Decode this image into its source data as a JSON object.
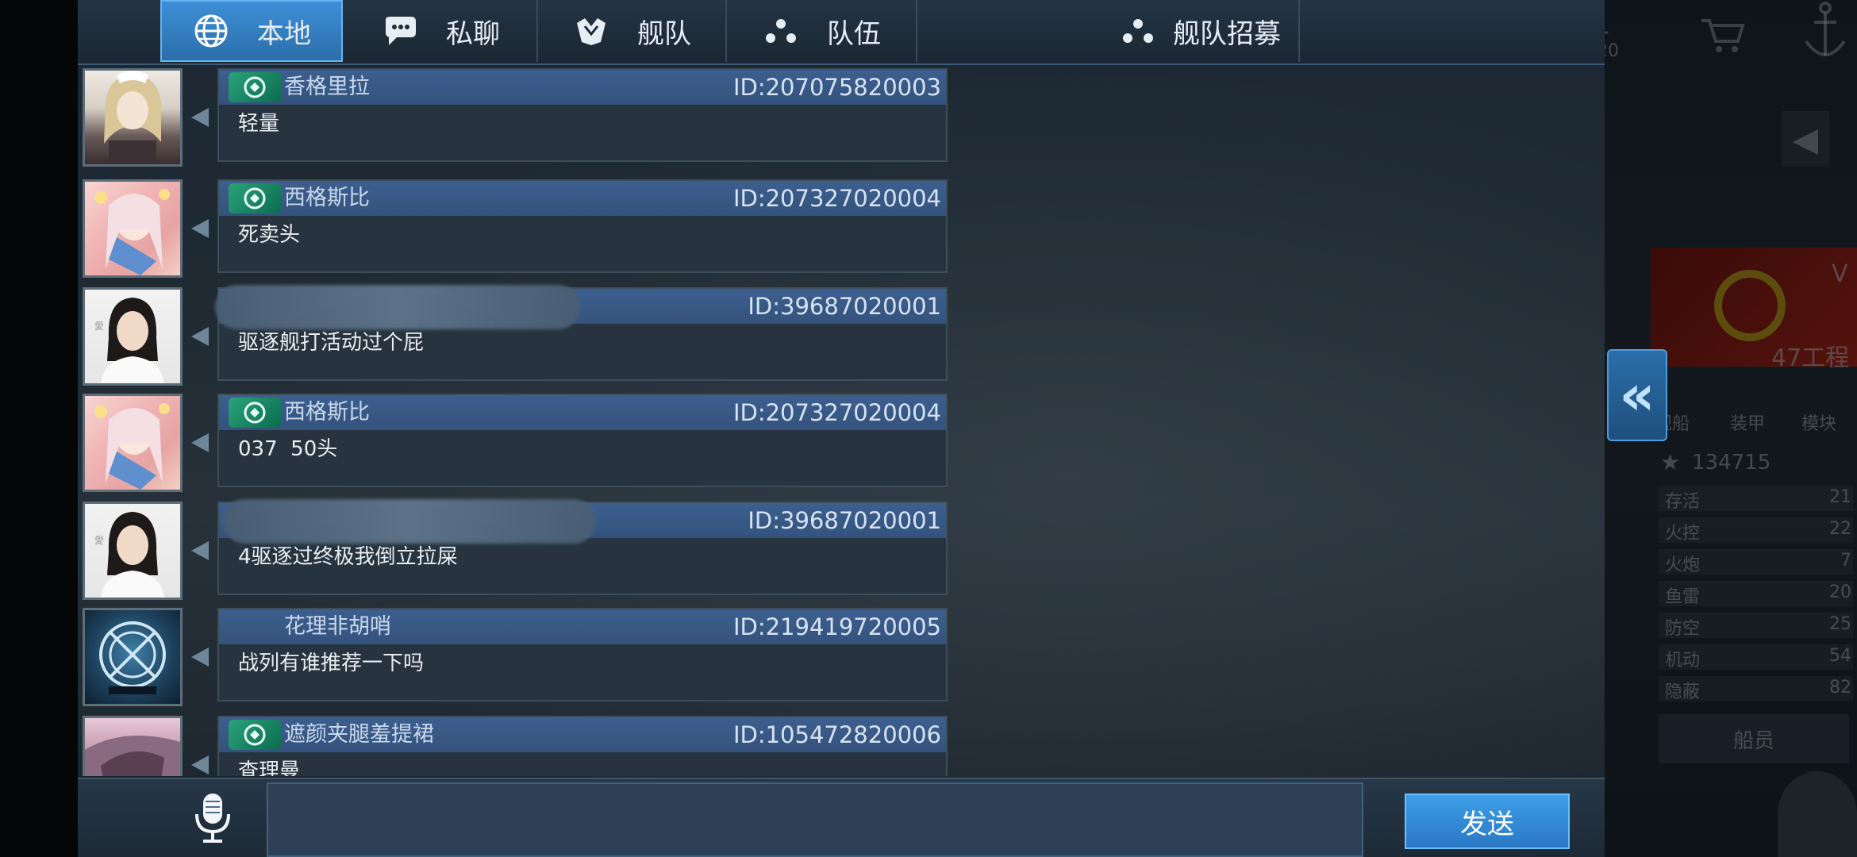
{
  "tabs": [
    {
      "label": "本地",
      "icon": "globe-icon",
      "active": true
    },
    {
      "label": "私聊",
      "icon": "speech-bubble-icon"
    },
    {
      "label": "舰队",
      "icon": "fleet-emblem-icon"
    },
    {
      "label": "队伍",
      "icon": "team-dots-icon"
    },
    {
      "label": "舰队招募",
      "icon": "team-dots-icon"
    }
  ],
  "messages": [
    {
      "sender": "香格里拉",
      "id": "ID:207075820003",
      "text": "轻量",
      "badge": true,
      "avatar": "portrait-maid"
    },
    {
      "sender": "西格斯比",
      "id": "ID:207327020004",
      "text": "死卖头",
      "badge": true,
      "avatar": "anime-pink"
    },
    {
      "sender": "",
      "id": "ID:39687020001",
      "text": "驱逐舰打活动过个屁",
      "badge": false,
      "blurred": true,
      "avatar": "portrait-nurse"
    },
    {
      "sender": "西格斯比",
      "id": "ID:207327020004",
      "text": "037  50头",
      "badge": true,
      "avatar": "anime-pink"
    },
    {
      "sender": "",
      "id": "ID:39687020001",
      "text": "4驱逐过终极我倒立拉屎",
      "badge": false,
      "blurred": true,
      "avatar": "portrait-nurse"
    },
    {
      "sender": "花理非胡哨",
      "id": "ID:219419720005",
      "text": "战列有谁推荐一下吗",
      "badge": false,
      "avatar": "emblem-ship"
    },
    {
      "sender": "遮颜夹腿羞提裙",
      "id": "ID:105472820006",
      "text": "查理曼",
      "badge": true,
      "avatar": "anime-purple"
    }
  ],
  "input": {
    "value": "",
    "placeholder": ""
  },
  "send_label": "发送",
  "background": {
    "ship_tabs": [
      "舰船",
      "装甲",
      "模块"
    ],
    "ship_name_partial": "47工程",
    "tier_partial": "V",
    "score": "134715",
    "stats": [
      {
        "name": "存活",
        "value": "21"
      },
      {
        "name": "火控",
        "value": "22"
      },
      {
        "name": "火炮",
        "value": "7"
      },
      {
        "name": "鱼雷",
        "value": "20"
      },
      {
        "name": "防空",
        "value": "25"
      },
      {
        "name": "机动",
        "value": "54"
      },
      {
        "name": "隐蔽",
        "value": "82"
      }
    ],
    "crew_button": "船员",
    "currency_partial": "20"
  },
  "colors": {
    "accent": "#3d8fd6",
    "bubble_header": "#3d5f8f",
    "bubble_body": "#27343f",
    "send_button": "#3e9ee8"
  }
}
